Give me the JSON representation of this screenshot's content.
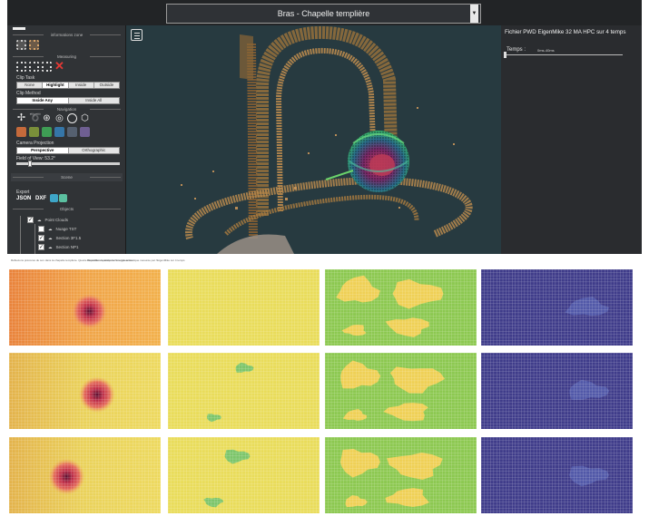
{
  "app": {
    "title": "Bras - Chapelle templière",
    "sidebar": {
      "sections": {
        "info_zone": "informations zone",
        "measuring": "Measuring",
        "navigation": "Navigation",
        "scene": "Scene",
        "objects": "Objects"
      },
      "clip_task": {
        "label": "Clip Task",
        "options": [
          "None",
          "Highlight",
          "Inside",
          "Outside"
        ],
        "active": "Highlight"
      },
      "clip_method": {
        "label": "Clip Method",
        "options": [
          "Inside Any",
          "Inside All"
        ],
        "active": "Inside Any"
      },
      "camera_projection": {
        "label": "Camera Projection",
        "options": [
          "Perspective",
          "Orthographic"
        ],
        "active": "Perspective"
      },
      "fov_label": "Field of View: 53.2°",
      "fov_value": 0.12,
      "export": {
        "label": "Export",
        "formats": [
          "JSON",
          "DXF"
        ]
      },
      "tree": [
        {
          "label": "Point Clouds",
          "checked": true
        },
        {
          "label": "Nuage TST",
          "checked": false
        },
        {
          "label": "Section 3F1.5",
          "checked": true
        },
        {
          "label": "Section NP1",
          "checked": true
        }
      ]
    },
    "info_panel": {
      "title": "Fichier PWD EigenMike 32 MA HPC sur 4 temps",
      "time_label": "Temps :",
      "time_value": "0ms-40ms",
      "time_position": 0
    },
    "colors": {
      "panel_bg": "#303336",
      "viewport_bg": "#273a40",
      "point_cloud": "#b98a4e",
      "sphere_hot": "#c0304a",
      "sphere_cool": "#2e8b57"
    }
  },
  "plots": {
    "caption_left": "Réflexions précoces du son dans la chapelle templière. Quatre intervalles de temps sont représentés.",
    "caption_mid": "Répartition spatiale de l'énergie acoustique mesurée par l'EigenMike sur 4 temps",
    "rows": 3,
    "columns": [
      {
        "colormap": "heat",
        "hotspots": [
          [
            0.53,
            0.55
          ],
          [
            0.58,
            0.55
          ],
          [
            0.38,
            0.52
          ]
        ]
      },
      {
        "colormap": "yellow-green"
      },
      {
        "colormap": "green-yellow"
      },
      {
        "colormap": "purple"
      }
    ]
  }
}
